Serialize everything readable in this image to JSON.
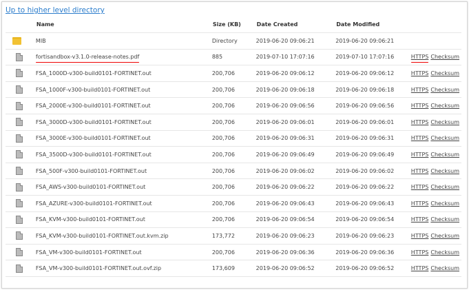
{
  "up_link": "Up to higher level directory",
  "headers": {
    "name": "Name",
    "size": "Size (KB)",
    "created": "Date Created",
    "modified": "Date Modified"
  },
  "link_https": "HTTPS",
  "link_checksum": "Checksum",
  "rows": [
    {
      "name": "MIB",
      "size": "Directory",
      "created": "2019-06-20 09:06:21",
      "modified": "2019-06-20 09:06:21",
      "type": "folder"
    },
    {
      "name": "fortisandbox-v3.1.0-release-notes.pdf",
      "size": "885",
      "created": "2019-07-10 17:07:16",
      "modified": "2019-07-10 17:07:16",
      "type": "file"
    },
    {
      "name": "FSA_1000D-v300-build0101-FORTINET.out",
      "size": "200,706",
      "created": "2019-06-20 09:06:12",
      "modified": "2019-06-20 09:06:12",
      "type": "file"
    },
    {
      "name": "FSA_1000F-v300-build0101-FORTINET.out",
      "size": "200,706",
      "created": "2019-06-20 09:06:18",
      "modified": "2019-06-20 09:06:18",
      "type": "file"
    },
    {
      "name": "FSA_2000E-v300-build0101-FORTINET.out",
      "size": "200,706",
      "created": "2019-06-20 09:06:56",
      "modified": "2019-06-20 09:06:56",
      "type": "file"
    },
    {
      "name": "FSA_3000D-v300-build0101-FORTINET.out",
      "size": "200,706",
      "created": "2019-06-20 09:06:01",
      "modified": "2019-06-20 09:06:01",
      "type": "file"
    },
    {
      "name": "FSA_3000E-v300-build0101-FORTINET.out",
      "size": "200,706",
      "created": "2019-06-20 09:06:31",
      "modified": "2019-06-20 09:06:31",
      "type": "file"
    },
    {
      "name": "FSA_3500D-v300-build0101-FORTINET.out",
      "size": "200,706",
      "created": "2019-06-20 09:06:49",
      "modified": "2019-06-20 09:06:49",
      "type": "file"
    },
    {
      "name": "FSA_500F-v300-build0101-FORTINET.out",
      "size": "200,706",
      "created": "2019-06-20 09:06:02",
      "modified": "2019-06-20 09:06:02",
      "type": "file"
    },
    {
      "name": "FSA_AWS-v300-build0101-FORTINET.out",
      "size": "200,706",
      "created": "2019-06-20 09:06:22",
      "modified": "2019-06-20 09:06:22",
      "type": "file"
    },
    {
      "name": "FSA_AZURE-v300-build0101-FORTINET.out",
      "size": "200,706",
      "created": "2019-06-20 09:06:43",
      "modified": "2019-06-20 09:06:43",
      "type": "file"
    },
    {
      "name": "FSA_KVM-v300-build0101-FORTINET.out",
      "size": "200,706",
      "created": "2019-06-20 09:06:54",
      "modified": "2019-06-20 09:06:54",
      "type": "file"
    },
    {
      "name": "FSA_KVM-v300-build0101-FORTINET.out.kvm.zip",
      "size": "173,772",
      "created": "2019-06-20 09:06:23",
      "modified": "2019-06-20 09:06:23",
      "type": "file"
    },
    {
      "name": "FSA_VM-v300-build0101-FORTINET.out",
      "size": "200,706",
      "created": "2019-06-20 09:06:36",
      "modified": "2019-06-20 09:06:36",
      "type": "file"
    },
    {
      "name": "FSA_VM-v300-build0101-FORTINET.out.ovf.zip",
      "size": "173,609",
      "created": "2019-06-20 09:06:52",
      "modified": "2019-06-20 09:06:52",
      "type": "file"
    }
  ]
}
